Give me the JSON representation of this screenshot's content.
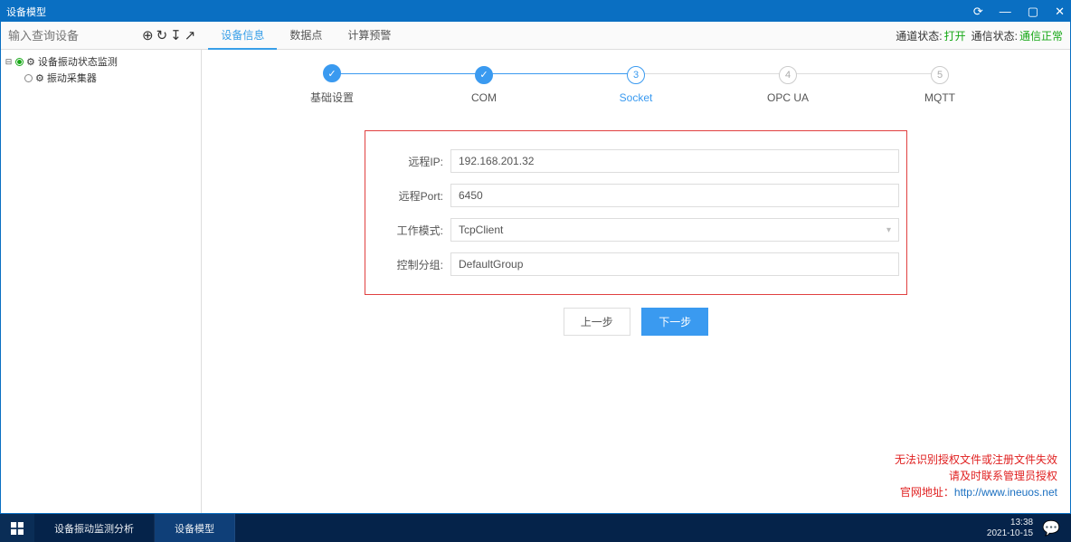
{
  "titlebar": {
    "title": "设备模型"
  },
  "search": {
    "placeholder": "输入查询设备"
  },
  "tabs": [
    {
      "label": "设备信息",
      "active": true
    },
    {
      "label": "数据点",
      "active": false
    },
    {
      "label": "计算预警",
      "active": false
    }
  ],
  "status": {
    "channel_label": "通道状态:",
    "channel_value": "打开",
    "comm_label": "通信状态:",
    "comm_value": "通信正常"
  },
  "tree": {
    "node1": "设备振动状态监测",
    "node2": "振动采集器"
  },
  "steps": [
    {
      "label": "基础设置",
      "state": "done",
      "mark": "✓"
    },
    {
      "label": "COM",
      "state": "done",
      "mark": "✓"
    },
    {
      "label": "Socket",
      "state": "active",
      "mark": "3"
    },
    {
      "label": "OPC UA",
      "state": "pending",
      "mark": "4"
    },
    {
      "label": "MQTT",
      "state": "pending",
      "mark": "5"
    }
  ],
  "form": {
    "remote_ip_label": "远程IP:",
    "remote_ip_value": "192.168.201.32",
    "remote_port_label": "远程Port:",
    "remote_port_value": "6450",
    "work_mode_label": "工作模式:",
    "work_mode_value": "TcpClient",
    "group_label": "控制分组:",
    "group_value": "DefaultGroup"
  },
  "buttons": {
    "prev": "上一步",
    "next": "下一步"
  },
  "license": {
    "line1": "无法识别授权文件或注册文件失效",
    "line2": "请及时联系管理员授权",
    "label": "官网地址：",
    "url": "http://www.ineuos.net"
  },
  "taskbar": {
    "item1": "设备振动监测分析",
    "item2": "设备模型",
    "time": "13:38",
    "date": "2021-10-15"
  }
}
